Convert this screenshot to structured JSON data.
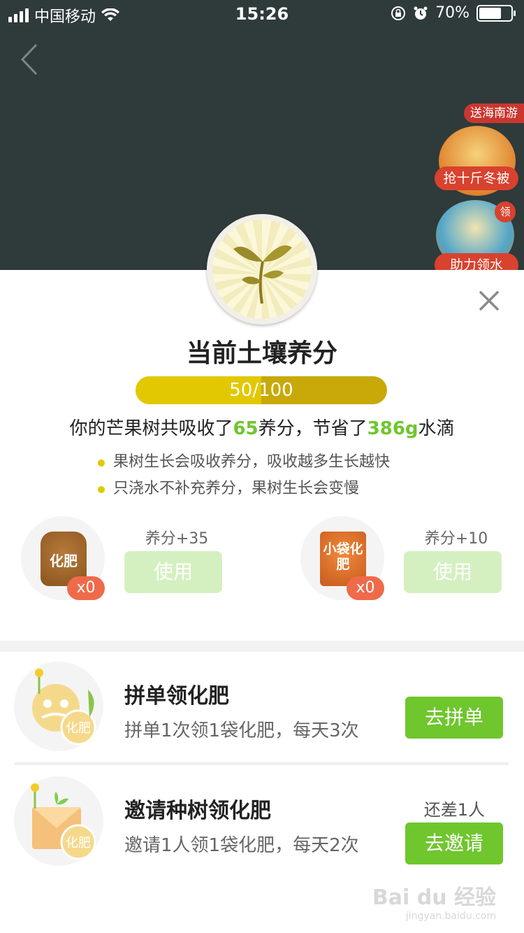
{
  "status_bar": {
    "carrier": "中国移动",
    "time": "15:26",
    "battery_label": "70%",
    "battery_level": 0.7
  },
  "background": {
    "promo_tag": "送海南游",
    "promo_label": "抢十斤冬被",
    "promo2_tag": "领",
    "promo2_label": "助力领水"
  },
  "sheet": {
    "title": "当前土壤养分",
    "progress": {
      "text": "50/100",
      "current": 50,
      "max": 100
    },
    "summary": {
      "prefix": "你的芒果树共吸收了",
      "nutrient_value": "65",
      "middle": "养分，节省了",
      "water_value": "386g",
      "suffix": "水滴"
    },
    "tips": [
      "果树生长会吸收养分，吸收越多生长越快",
      "只浇水不补充养分，果树生长会变慢"
    ],
    "items": [
      {
        "icon": "fertilizer-bag-icon",
        "bag_label": "化肥",
        "count": "x0",
        "gain": "养分+35",
        "button": "使用"
      },
      {
        "icon": "small-fertilizer-bag-icon",
        "bag_label": "小袋化肥",
        "count": "x0",
        "gain": "养分+10",
        "button": "使用"
      }
    ],
    "tasks": [
      {
        "icon": "group-buy-fertilizer-icon",
        "icon_label": "化肥",
        "title": "拼单领化肥",
        "desc": "拼单1次领1袋化肥，每天3次",
        "button": "去拼单"
      },
      {
        "icon": "invite-fertilizer-icon",
        "icon_label": "化肥",
        "title": "邀请种树领化肥",
        "desc": "邀请1人领1袋化肥，每天2次",
        "button": "去邀请",
        "extra": "还差1人"
      }
    ]
  },
  "watermark": {
    "main": "Bai du 经验",
    "sub": "jingyan.baidu.com"
  },
  "colors": {
    "accent_green": "#6fc62d",
    "progress_yellow": "#e2c800",
    "badge_red": "#ef6a4a"
  }
}
